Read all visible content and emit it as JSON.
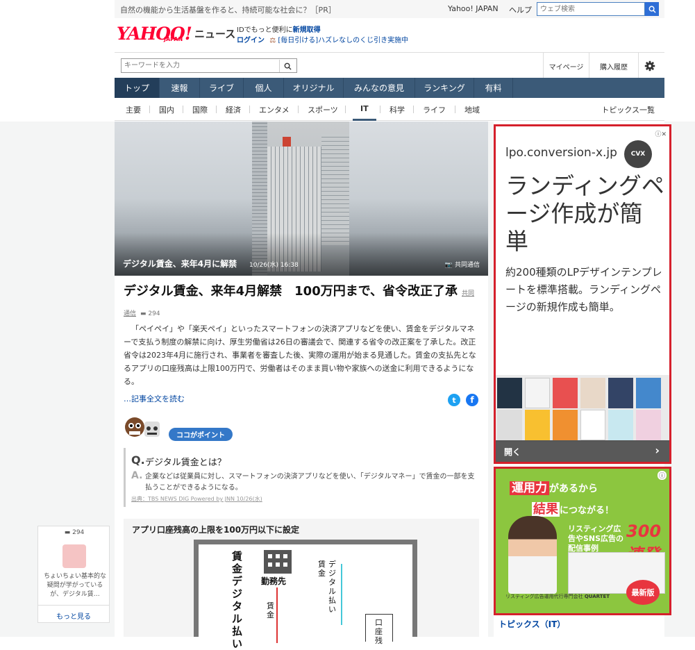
{
  "header": {
    "pr_text": "自然の機能から生活基盤を作ると、持続可能な社会に？［PR］",
    "yahoo_japan_link": "Yahoo! JAPAN",
    "help_link": "ヘルプ",
    "web_search_placeholder": "ウェブ検索",
    "logo_text": "YAHOO!",
    "logo_sub": "JAPAN",
    "news_label": "ニュース",
    "id_text": "IDでもっと便利に",
    "id_register": "新規取得",
    "login": "ログイン",
    "lottery_text": "[毎日引ける]ハズレなしのくじ引き実施中",
    "keyword_placeholder": "キーワードを入力",
    "mypage": "マイページ",
    "purchase_history": "購入履歴"
  },
  "main_nav": [
    "トップ",
    "速報",
    "ライブ",
    "個人",
    "オリジナル",
    "みんなの意見",
    "ランキング",
    "有料"
  ],
  "sub_nav": {
    "items": [
      "主要",
      "国内",
      "国際",
      "経済",
      "エンタメ",
      "スポーツ",
      "IT",
      "科学",
      "ライフ",
      "地域"
    ],
    "topics_list": "トピックス一覧"
  },
  "hero": {
    "caption": "デジタル賃金、来年4月に解禁",
    "time": "10/26(水) 16:38",
    "credit": "共同通信"
  },
  "article": {
    "title": "デジタル賃金、来年4月解禁　100万円まで、省令改正了承",
    "source": "共同通信",
    "comments": "294",
    "body": "「ペイペイ」や「楽天ペイ」といったスマートフォンの決済アプリなどを使い、賃金をデジタルマネーで支払う制度の解禁に向け、厚生労働省は26日の審議会で、関連する省令の改正案を了承した。改正省令は2023年4月に施行され、事業者を審査した後、実際の運用が始まる見通した。賃金の支払先となるアプリの口座残高は上限100万円で、労働者はそのまま買い物や家族への送金に利用できるようになる。",
    "read_more": "…記事全文を読む"
  },
  "point": {
    "badge": "ココがポイント",
    "q_label": "Q.",
    "question": "デジタル賃金とは？",
    "a_label": "A.",
    "answer": "企業などは従業員に対し、スマートフォンの決済アプリなどを使い、「デジタルマネー」で賃金の一部を支払うことができるようになる。",
    "source": "出典：TBS NEWS DIG Powered by JNN 10/26(水)"
  },
  "figure": {
    "title": "アプリ口座残高の上限を100万円以下に設定",
    "vertical_title": "賃金デジタル払い",
    "employer": "勤務先",
    "wage": "賃金",
    "digital_pay_1": "賃金",
    "digital_pay_2": "デジタル払い",
    "account": "口座残"
  },
  "comment_widget": {
    "count": "294",
    "text": "ちょいちょい基本的な疑問が学がっているが、デジタル賃…",
    "more": "もっと見る"
  },
  "ad1": {
    "domain": "lpo.conversion-x.jp",
    "logo": "CVX",
    "headline": "ランディングページ作成が簡単",
    "description": "約200種類のLPデザインテンプレートを標準搭載。ランディングページの新規作成も簡単。",
    "open": "開く",
    "next": "›"
  },
  "ad2": {
    "line1_hl": "運用力",
    "line1_rest": "があるから",
    "line2_hl": "結果",
    "line2_rest": "につながる！",
    "case_text": "リスティング広告やSNS広告の配信事例",
    "count": "300連発",
    "company": "リスティング広告運用代行専門会社",
    "company2": "QUARTET",
    "new_badge": "最新版"
  },
  "topics_it": "トピックス（IT）",
  "colors": {
    "nav": "#3b5a78",
    "accent": "#d5202c",
    "link": "#0045a0"
  }
}
